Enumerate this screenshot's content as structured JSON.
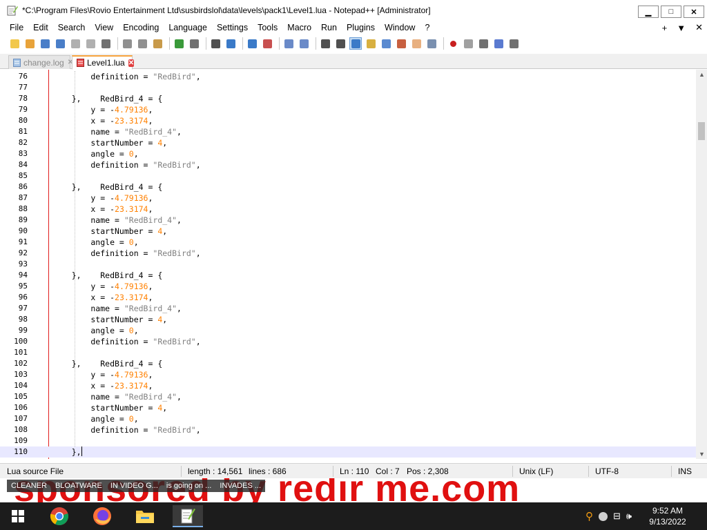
{
  "window": {
    "title": "*C:\\Program Files\\Rovio Entertainment Ltd\\susbirdslol\\data\\levels\\pack1\\Level1.lua - Notepad++ [Administrator]",
    "min_label": "▁",
    "max_label": "□",
    "close_label": "✕"
  },
  "menu": {
    "items": [
      "File",
      "Edit",
      "Search",
      "View",
      "Encoding",
      "Language",
      "Settings",
      "Tools",
      "Macro",
      "Run",
      "Plugins",
      "Window",
      "?"
    ],
    "right_plus": "+",
    "right_down": "▼",
    "right_close": "✕"
  },
  "toolbar": {
    "icons": [
      "new-file-icon",
      "open-file-icon",
      "save-icon",
      "save-all-icon",
      "close-icon",
      "close-all-icon",
      "print-icon",
      "cut-icon",
      "copy-icon",
      "paste-icon",
      "undo-icon",
      "redo-icon",
      "find-icon",
      "replace-icon",
      "zoom-in-icon",
      "zoom-out-icon",
      "sync-vertical-icon",
      "sync-horizontal-icon",
      "word-wrap-icon",
      "show-all-chars-icon",
      "indent-guide-icon",
      "user-language-icon",
      "document-map-icon",
      "function-list-icon",
      "folder-workspace-icon",
      "monitoring-icon",
      "record-macro-icon",
      "stop-macro-icon",
      "play-macro-icon",
      "run-macro-multiple-icon",
      "save-macro-icon"
    ]
  },
  "tabs": [
    {
      "label": "change.log",
      "active": false
    },
    {
      "label": "Level1.lua",
      "active": true
    }
  ],
  "editor": {
    "lines": [
      {
        "n": "76",
        "parts": [
          [
            "t",
            "        definition = "
          ],
          [
            "s",
            "\"RedBird\""
          ],
          [
            "t",
            ","
          ]
        ]
      },
      {
        "n": "77",
        "parts": []
      },
      {
        "n": "78",
        "parts": [
          [
            "t",
            "    },    RedBird_4 = {"
          ]
        ]
      },
      {
        "n": "79",
        "parts": [
          [
            "t",
            "        y = -"
          ],
          [
            "n",
            "4.79136"
          ],
          [
            "t",
            ","
          ]
        ]
      },
      {
        "n": "80",
        "parts": [
          [
            "t",
            "        x = -"
          ],
          [
            "n",
            "23.3174"
          ],
          [
            "t",
            ","
          ]
        ]
      },
      {
        "n": "81",
        "parts": [
          [
            "t",
            "        name = "
          ],
          [
            "s",
            "\"RedBird_4\""
          ],
          [
            "t",
            ","
          ]
        ]
      },
      {
        "n": "82",
        "parts": [
          [
            "t",
            "        startNumber = "
          ],
          [
            "n",
            "4"
          ],
          [
            "t",
            ","
          ]
        ]
      },
      {
        "n": "83",
        "parts": [
          [
            "t",
            "        angle = "
          ],
          [
            "n",
            "0"
          ],
          [
            "t",
            ","
          ]
        ]
      },
      {
        "n": "84",
        "parts": [
          [
            "t",
            "        definition = "
          ],
          [
            "s",
            "\"RedBird\""
          ],
          [
            "t",
            ","
          ]
        ]
      },
      {
        "n": "85",
        "parts": []
      },
      {
        "n": "86",
        "parts": [
          [
            "t",
            "    },    RedBird_4 = {"
          ]
        ]
      },
      {
        "n": "87",
        "parts": [
          [
            "t",
            "        y = -"
          ],
          [
            "n",
            "4.79136"
          ],
          [
            "t",
            ","
          ]
        ]
      },
      {
        "n": "88",
        "parts": [
          [
            "t",
            "        x = -"
          ],
          [
            "n",
            "23.3174"
          ],
          [
            "t",
            ","
          ]
        ]
      },
      {
        "n": "89",
        "parts": [
          [
            "t",
            "        name = "
          ],
          [
            "s",
            "\"RedBird_4\""
          ],
          [
            "t",
            ","
          ]
        ]
      },
      {
        "n": "90",
        "parts": [
          [
            "t",
            "        startNumber = "
          ],
          [
            "n",
            "4"
          ],
          [
            "t",
            ","
          ]
        ]
      },
      {
        "n": "91",
        "parts": [
          [
            "t",
            "        angle = "
          ],
          [
            "n",
            "0"
          ],
          [
            "t",
            ","
          ]
        ]
      },
      {
        "n": "92",
        "parts": [
          [
            "t",
            "        definition = "
          ],
          [
            "s",
            "\"RedBird\""
          ],
          [
            "t",
            ","
          ]
        ]
      },
      {
        "n": "93",
        "parts": []
      },
      {
        "n": "94",
        "parts": [
          [
            "t",
            "    },    RedBird_4 = {"
          ]
        ]
      },
      {
        "n": "95",
        "parts": [
          [
            "t",
            "        y = -"
          ],
          [
            "n",
            "4.79136"
          ],
          [
            "t",
            ","
          ]
        ]
      },
      {
        "n": "96",
        "parts": [
          [
            "t",
            "        x = -"
          ],
          [
            "n",
            "23.3174"
          ],
          [
            "t",
            ","
          ]
        ]
      },
      {
        "n": "97",
        "parts": [
          [
            "t",
            "        name = "
          ],
          [
            "s",
            "\"RedBird_4\""
          ],
          [
            "t",
            ","
          ]
        ]
      },
      {
        "n": "98",
        "parts": [
          [
            "t",
            "        startNumber = "
          ],
          [
            "n",
            "4"
          ],
          [
            "t",
            ","
          ]
        ]
      },
      {
        "n": "99",
        "parts": [
          [
            "t",
            "        angle = "
          ],
          [
            "n",
            "0"
          ],
          [
            "t",
            ","
          ]
        ]
      },
      {
        "n": "100",
        "parts": [
          [
            "t",
            "        definition = "
          ],
          [
            "s",
            "\"RedBird\""
          ],
          [
            "t",
            ","
          ]
        ]
      },
      {
        "n": "101",
        "parts": []
      },
      {
        "n": "102",
        "parts": [
          [
            "t",
            "    },    RedBird_4 = {"
          ]
        ]
      },
      {
        "n": "103",
        "parts": [
          [
            "t",
            "        y = -"
          ],
          [
            "n",
            "4.79136"
          ],
          [
            "t",
            ","
          ]
        ]
      },
      {
        "n": "104",
        "parts": [
          [
            "t",
            "        x = -"
          ],
          [
            "n",
            "23.3174"
          ],
          [
            "t",
            ","
          ]
        ]
      },
      {
        "n": "105",
        "parts": [
          [
            "t",
            "        name = "
          ],
          [
            "s",
            "\"RedBird_4\""
          ],
          [
            "t",
            ","
          ]
        ]
      },
      {
        "n": "106",
        "parts": [
          [
            "t",
            "        startNumber = "
          ],
          [
            "n",
            "4"
          ],
          [
            "t",
            ","
          ]
        ]
      },
      {
        "n": "107",
        "parts": [
          [
            "t",
            "        angle = "
          ],
          [
            "n",
            "0"
          ],
          [
            "t",
            ","
          ]
        ]
      },
      {
        "n": "108",
        "parts": [
          [
            "t",
            "        definition = "
          ],
          [
            "s",
            "\"RedBird\""
          ],
          [
            "t",
            ","
          ]
        ]
      },
      {
        "n": "109",
        "parts": []
      },
      {
        "n": "110",
        "parts": [
          [
            "t",
            "    },"
          ]
        ],
        "current": true
      }
    ]
  },
  "status": {
    "file_type": "Lua source File",
    "length": "length : 14,561",
    "lines": "lines : 686",
    "ln": "Ln : 110",
    "col": "Col : 7",
    "pos": "Pos : 2,308",
    "eol": "Unix (LF)",
    "encoding": "UTF-8",
    "mode": "INS"
  },
  "banner": {
    "big_text": "sponsored by redir me.com",
    "ticker": [
      "CLEANER",
      "BLOATWARE",
      "IN VIDEO G...",
      "is going on ...",
      "INVADES ..."
    ]
  },
  "taskbar": {
    "apps": [
      "windows-start-icon",
      "chrome-icon",
      "firefox-icon",
      "file-explorer-icon",
      "notepadpp-icon"
    ],
    "time": "9:52 AM",
    "date": "9/13/2022"
  },
  "colors": {
    "number": "#ff8000",
    "string": "#808080",
    "fold_margin": "#e21e1e",
    "current_line": "#e8e8ff",
    "active_tab_accent": "#f7a33c",
    "banner_text": "#e01010",
    "taskbar": "#1c1c1c"
  }
}
